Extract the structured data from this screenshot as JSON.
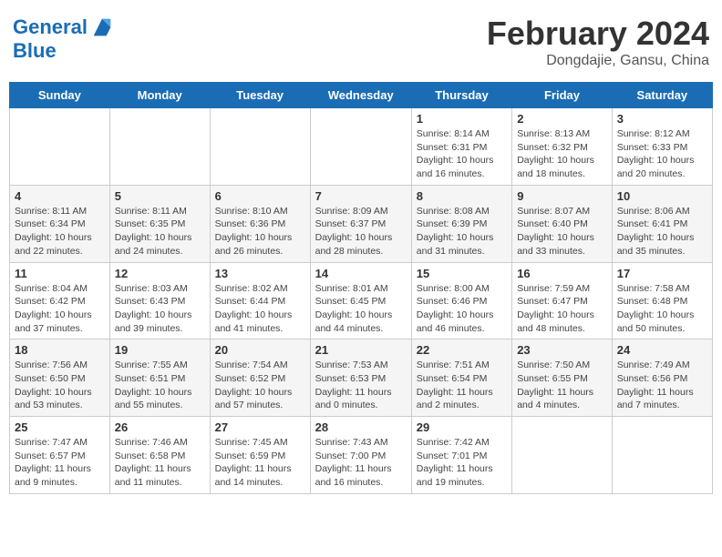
{
  "header": {
    "logo_line1": "General",
    "logo_line2": "Blue",
    "title": "February 2024",
    "subtitle": "Dongdajie, Gansu, China"
  },
  "days_of_week": [
    "Sunday",
    "Monday",
    "Tuesday",
    "Wednesday",
    "Thursday",
    "Friday",
    "Saturday"
  ],
  "weeks": [
    [
      {
        "day": "",
        "info": ""
      },
      {
        "day": "",
        "info": ""
      },
      {
        "day": "",
        "info": ""
      },
      {
        "day": "",
        "info": ""
      },
      {
        "day": "1",
        "info": "Sunrise: 8:14 AM\nSunset: 6:31 PM\nDaylight: 10 hours and 16 minutes."
      },
      {
        "day": "2",
        "info": "Sunrise: 8:13 AM\nSunset: 6:32 PM\nDaylight: 10 hours and 18 minutes."
      },
      {
        "day": "3",
        "info": "Sunrise: 8:12 AM\nSunset: 6:33 PM\nDaylight: 10 hours and 20 minutes."
      }
    ],
    [
      {
        "day": "4",
        "info": "Sunrise: 8:11 AM\nSunset: 6:34 PM\nDaylight: 10 hours and 22 minutes."
      },
      {
        "day": "5",
        "info": "Sunrise: 8:11 AM\nSunset: 6:35 PM\nDaylight: 10 hours and 24 minutes."
      },
      {
        "day": "6",
        "info": "Sunrise: 8:10 AM\nSunset: 6:36 PM\nDaylight: 10 hours and 26 minutes."
      },
      {
        "day": "7",
        "info": "Sunrise: 8:09 AM\nSunset: 6:37 PM\nDaylight: 10 hours and 28 minutes."
      },
      {
        "day": "8",
        "info": "Sunrise: 8:08 AM\nSunset: 6:39 PM\nDaylight: 10 hours and 31 minutes."
      },
      {
        "day": "9",
        "info": "Sunrise: 8:07 AM\nSunset: 6:40 PM\nDaylight: 10 hours and 33 minutes."
      },
      {
        "day": "10",
        "info": "Sunrise: 8:06 AM\nSunset: 6:41 PM\nDaylight: 10 hours and 35 minutes."
      }
    ],
    [
      {
        "day": "11",
        "info": "Sunrise: 8:04 AM\nSunset: 6:42 PM\nDaylight: 10 hours and 37 minutes."
      },
      {
        "day": "12",
        "info": "Sunrise: 8:03 AM\nSunset: 6:43 PM\nDaylight: 10 hours and 39 minutes."
      },
      {
        "day": "13",
        "info": "Sunrise: 8:02 AM\nSunset: 6:44 PM\nDaylight: 10 hours and 41 minutes."
      },
      {
        "day": "14",
        "info": "Sunrise: 8:01 AM\nSunset: 6:45 PM\nDaylight: 10 hours and 44 minutes."
      },
      {
        "day": "15",
        "info": "Sunrise: 8:00 AM\nSunset: 6:46 PM\nDaylight: 10 hours and 46 minutes."
      },
      {
        "day": "16",
        "info": "Sunrise: 7:59 AM\nSunset: 6:47 PM\nDaylight: 10 hours and 48 minutes."
      },
      {
        "day": "17",
        "info": "Sunrise: 7:58 AM\nSunset: 6:48 PM\nDaylight: 10 hours and 50 minutes."
      }
    ],
    [
      {
        "day": "18",
        "info": "Sunrise: 7:56 AM\nSunset: 6:50 PM\nDaylight: 10 hours and 53 minutes."
      },
      {
        "day": "19",
        "info": "Sunrise: 7:55 AM\nSunset: 6:51 PM\nDaylight: 10 hours and 55 minutes."
      },
      {
        "day": "20",
        "info": "Sunrise: 7:54 AM\nSunset: 6:52 PM\nDaylight: 10 hours and 57 minutes."
      },
      {
        "day": "21",
        "info": "Sunrise: 7:53 AM\nSunset: 6:53 PM\nDaylight: 11 hours and 0 minutes."
      },
      {
        "day": "22",
        "info": "Sunrise: 7:51 AM\nSunset: 6:54 PM\nDaylight: 11 hours and 2 minutes."
      },
      {
        "day": "23",
        "info": "Sunrise: 7:50 AM\nSunset: 6:55 PM\nDaylight: 11 hours and 4 minutes."
      },
      {
        "day": "24",
        "info": "Sunrise: 7:49 AM\nSunset: 6:56 PM\nDaylight: 11 hours and 7 minutes."
      }
    ],
    [
      {
        "day": "25",
        "info": "Sunrise: 7:47 AM\nSunset: 6:57 PM\nDaylight: 11 hours and 9 minutes."
      },
      {
        "day": "26",
        "info": "Sunrise: 7:46 AM\nSunset: 6:58 PM\nDaylight: 11 hours and 11 minutes."
      },
      {
        "day": "27",
        "info": "Sunrise: 7:45 AM\nSunset: 6:59 PM\nDaylight: 11 hours and 14 minutes."
      },
      {
        "day": "28",
        "info": "Sunrise: 7:43 AM\nSunset: 7:00 PM\nDaylight: 11 hours and 16 minutes."
      },
      {
        "day": "29",
        "info": "Sunrise: 7:42 AM\nSunset: 7:01 PM\nDaylight: 11 hours and 19 minutes."
      },
      {
        "day": "",
        "info": ""
      },
      {
        "day": "",
        "info": ""
      }
    ]
  ]
}
